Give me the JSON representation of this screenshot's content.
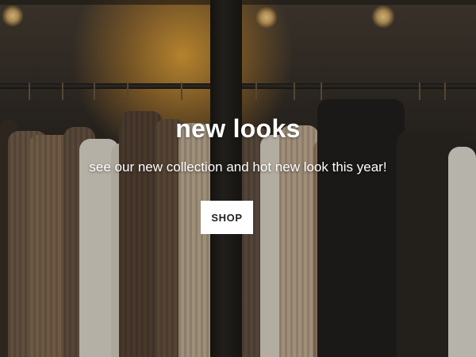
{
  "hero": {
    "title": "new looks",
    "subtitle": "see our new collection and hot new look this year!",
    "button_label": "SHOP"
  },
  "colors": {
    "text": "#ffffff",
    "button_bg": "#ffffff",
    "button_text": "#222222"
  }
}
